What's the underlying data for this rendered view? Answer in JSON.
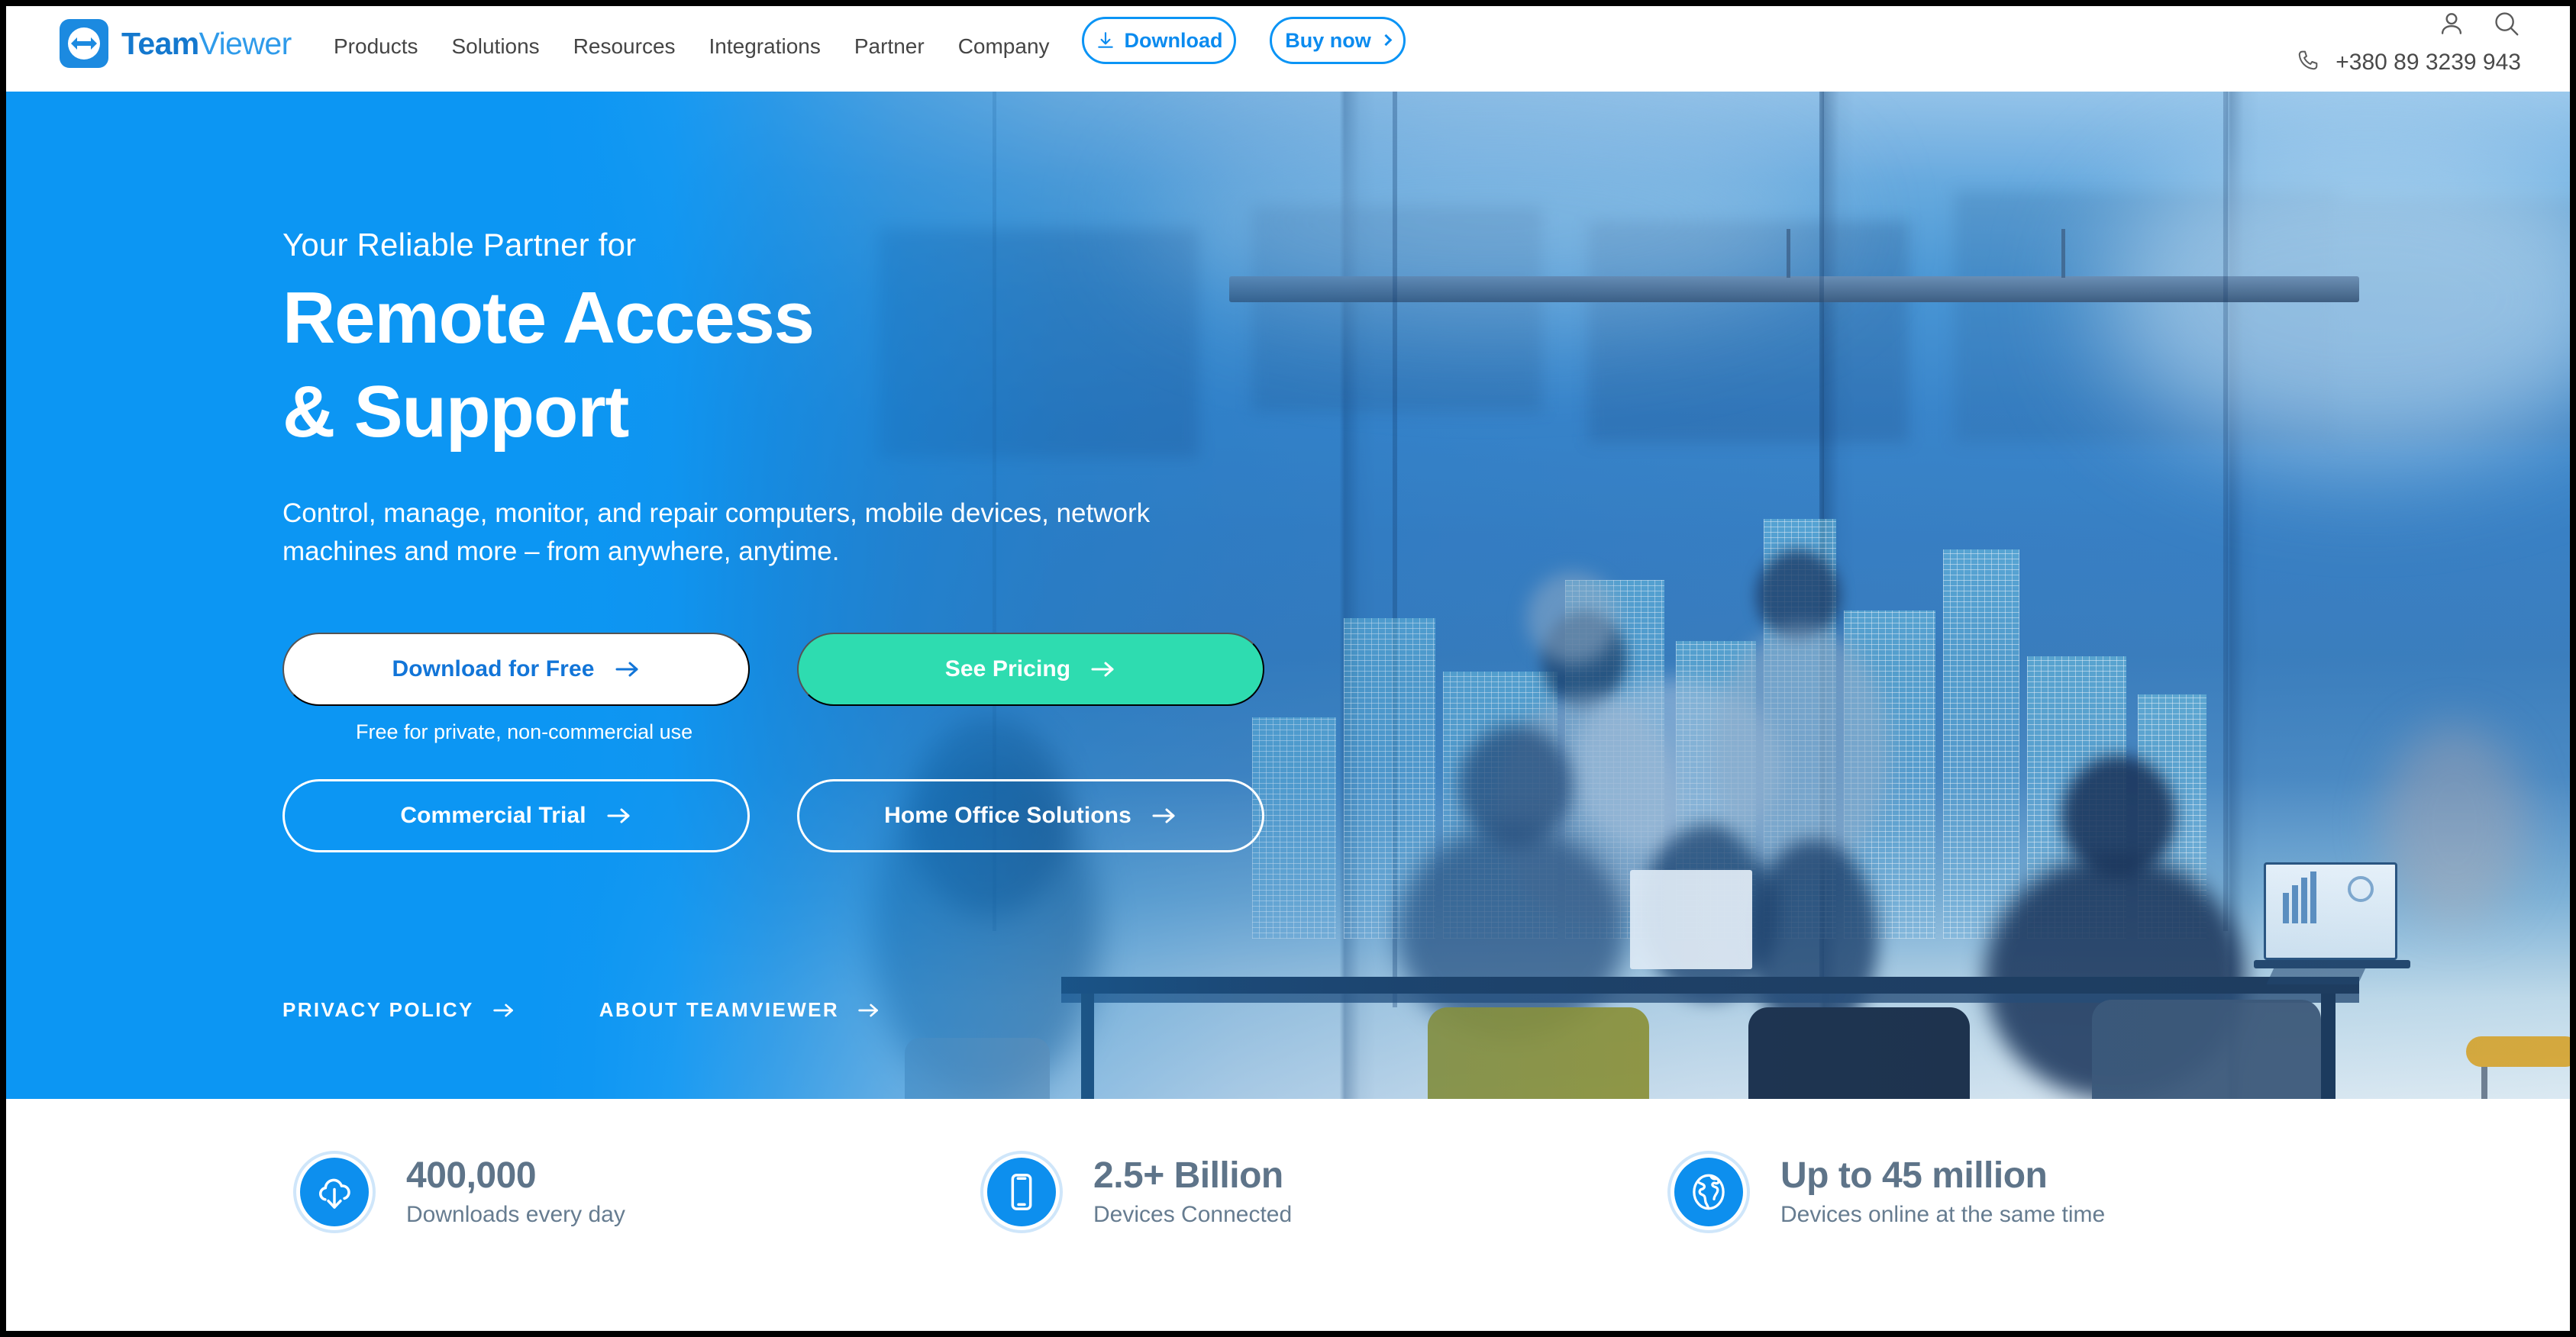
{
  "brand": {
    "name_bold": "Team",
    "name_light": "Viewer",
    "logo_icon": "teamviewer-logo-icon",
    "accent_blue": "#0C96F3",
    "accent_green": "#2EDCB0",
    "link_blue": "#0B8BEF"
  },
  "header": {
    "nav": [
      {
        "label": "Products"
      },
      {
        "label": "Solutions"
      },
      {
        "label": "Resources"
      },
      {
        "label": "Integrations"
      },
      {
        "label": "Partner"
      },
      {
        "label": "Company"
      }
    ],
    "download_button": {
      "label": "Download",
      "icon": "download-icon"
    },
    "buy_button": {
      "label": "Buy now",
      "icon": "chevron-right-icon"
    },
    "account_icon": "user-account-icon",
    "search_icon": "search-icon",
    "phone_icon": "phone-icon",
    "phone_number": "+380 89 3239 943"
  },
  "hero": {
    "eyebrow": "Your Reliable Partner for",
    "title": "Remote Access\n& Support",
    "subtitle": "Control, manage, monitor, and repair computers, mobile devices, network\nmachines and more – from anywhere, anytime.",
    "primary_ctas": [
      {
        "label": "Download for Free",
        "style": "white",
        "icon": "arrow-right-icon"
      },
      {
        "label": "See Pricing",
        "style": "green",
        "icon": "arrow-right-icon"
      }
    ],
    "free_note": "Free for private, non-commercial use",
    "secondary_ctas": [
      {
        "label": "Commercial Trial",
        "style": "ghost",
        "icon": "arrow-right-icon"
      },
      {
        "label": "Home Office Solutions",
        "style": "ghost",
        "icon": "arrow-right-icon"
      }
    ],
    "footer_links": [
      {
        "label": "PRIVACY POLICY",
        "icon": "arrow-right-icon"
      },
      {
        "label": "ABOUT TEAMVIEWER",
        "icon": "arrow-right-icon"
      }
    ]
  },
  "stats": [
    {
      "value": "400,000",
      "label": "Downloads every day",
      "icon": "cloud-download-icon"
    },
    {
      "value": "2.5+ Billion",
      "label": "Devices Connected",
      "icon": "mobile-phone-icon"
    },
    {
      "value": "Up to 45 million",
      "label": "Devices online at the same time",
      "icon": "globe-icon"
    }
  ]
}
